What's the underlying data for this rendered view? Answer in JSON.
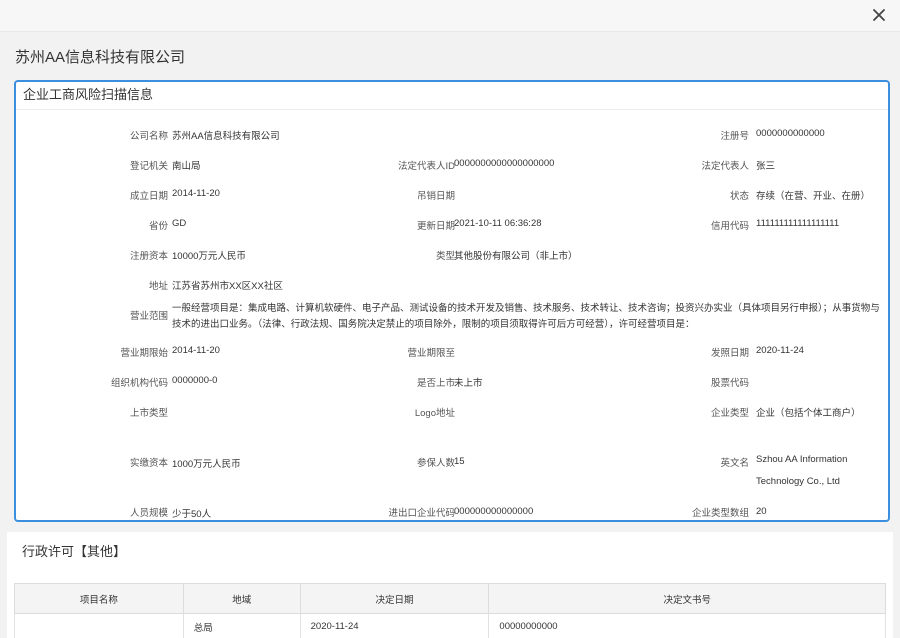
{
  "dialog": {
    "close_icon": "close-icon"
  },
  "company_name_title": "苏州AA信息科技有限公司",
  "risk_panel": {
    "title": "企业工商风险扫描信息",
    "fields": {
      "company_name": {
        "label": "公司名称",
        "value": "苏州AA信息科技有限公司"
      },
      "reg_no": {
        "label": "注册号",
        "value": "0000000000000"
      },
      "reg_authority": {
        "label": "登记机关",
        "value": "南山局"
      },
      "legal_rep_id": {
        "label": "法定代表人ID",
        "value": "0000000000000000000"
      },
      "legal_rep": {
        "label": "法定代表人",
        "value": "张三"
      },
      "est_date": {
        "label": "成立日期",
        "value": "2014-11-20"
      },
      "revoke_date": {
        "label": "吊销日期",
        "value": ""
      },
      "status": {
        "label": "状态",
        "value": "存续（在营、开业、在册）"
      },
      "province": {
        "label": "省份",
        "value": "GD"
      },
      "update_date": {
        "label": "更新日期",
        "value": "2021-10-11 06:36:28"
      },
      "credit_code": {
        "label": "信用代码",
        "value": "111111111111111111"
      },
      "reg_capital": {
        "label": "注册资本",
        "value": "10000万元人民币"
      },
      "type": {
        "label": "类型",
        "value": "其他股份有限公司（非上市）"
      },
      "address": {
        "label": "地址",
        "value": "江苏省苏州市XX区XX社区"
      },
      "scope": {
        "label": "营业范围",
        "value": "一般经营项目是：集成电路、计算机软硬件、电子产品、测试设备的技术开发及销售、技术服务、技术转让、技术咨询；投资兴办实业（具体项目另行申报）；从事货物与技术的进出口业务。（法律、行政法规、国务院决定禁止的项目除外，限制的项目须取得许可后方可经营），许可经营项目是："
      },
      "term_start": {
        "label": "营业期限始",
        "value": "2014-11-20"
      },
      "term_end": {
        "label": "营业期限至",
        "value": ""
      },
      "issue_date": {
        "label": "发照日期",
        "value": "2020-11-24"
      },
      "org_code": {
        "label": "组织机构代码",
        "value": "0000000-0"
      },
      "is_listed": {
        "label": "是否上市",
        "value": "未上市"
      },
      "stock_code": {
        "label": "股票代码",
        "value": ""
      },
      "listing_type": {
        "label": "上市类型",
        "value": ""
      },
      "logo_url": {
        "label": "Logo地址",
        "value": ""
      },
      "enterprise_type": {
        "label": "企业类型",
        "value": "企业（包括个体工商户）"
      },
      "paid_capital": {
        "label": "实缴资本",
        "value": "1000万元人民币"
      },
      "insured_count": {
        "label": "参保人数",
        "value": "15"
      },
      "english_name": {
        "label": "英文名",
        "value": "Szhou AA Information Technology Co., Ltd"
      },
      "staff_size": {
        "label": "人员规模",
        "value": "少于50人"
      },
      "import_export_code": {
        "label": "进出口企业代码",
        "value": "000000000000000"
      },
      "enterprise_type_group": {
        "label": "企业类型数组",
        "value": "20"
      }
    }
  },
  "permits": {
    "title": "行政许可【其他】",
    "columns": [
      "项目名称",
      "地域",
      "决定日期",
      "决定文书号"
    ],
    "rows": [
      [
        "",
        "总局",
        "2020-11-24",
        "00000000000"
      ]
    ]
  }
}
